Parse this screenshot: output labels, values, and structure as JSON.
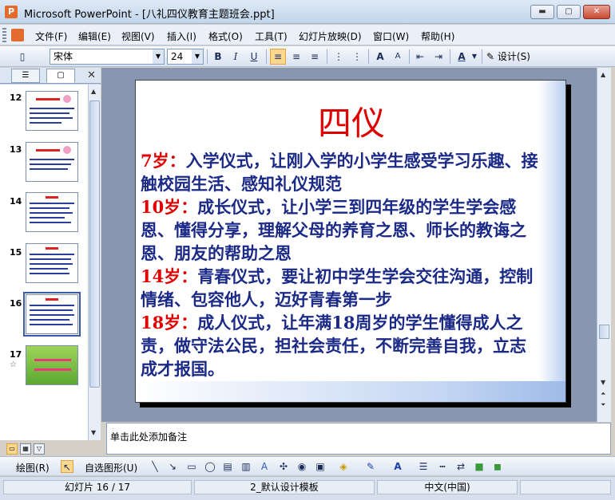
{
  "window": {
    "title": "Microsoft PowerPoint - [八礼四仪教育主题班会.ppt]",
    "min_label": "▬",
    "max_label": "▢",
    "close_label": "✕"
  },
  "menubar": {
    "items": [
      "文件(F)",
      "编辑(E)",
      "视图(V)",
      "插入(I)",
      "格式(O)",
      "工具(T)",
      "幻灯片放映(D)",
      "窗口(W)",
      "帮助(H)"
    ]
  },
  "toolbar": {
    "font_name": "宋体",
    "font_size": "24",
    "bold": "B",
    "italic": "I",
    "underline": "U",
    "grow_font": "A",
    "shrink_font": "A",
    "font_color": "A",
    "design_label": "设计(S)"
  },
  "panel": {
    "tab_outline": "☰",
    "tab_slides": "▢",
    "close": "✕"
  },
  "thumbnails": [
    {
      "num": "12"
    },
    {
      "num": "13"
    },
    {
      "num": "14"
    },
    {
      "num": "15"
    },
    {
      "num": "16"
    },
    {
      "num": "17"
    }
  ],
  "slide": {
    "title": "四仪",
    "paragraphs": [
      {
        "age": "7岁：",
        "text": "入学仪式，让刚入学的小学生感受学习乐趣、接触校园生活、感知礼仪规范"
      },
      {
        "age": "10岁：",
        "text": "成长仪式，让小学三到四年级的学生学会感恩、懂得分享，理解父母的养育之恩、师长的教诲之恩、朋友的帮助之恩"
      },
      {
        "age": "14岁：",
        "text": "青春仪式，要让初中学生学会交往沟通，控制情绪、包容他人，迈好青春第一步"
      },
      {
        "age": "18岁：",
        "text": "成人仪式，让年满18周岁的学生懂得成人之责，做守法公民，担社会责任，不断完善自我，立志成才报国。"
      }
    ]
  },
  "notes": {
    "placeholder": "单击此处添加备注"
  },
  "drawbar": {
    "draw_label": "绘图(R)",
    "autoshape_label": "自选图形(U)"
  },
  "status": {
    "slide_info": "幻灯片 16 / 17",
    "design_template": "2_默认设计模板",
    "language": "中文(中国)"
  },
  "colors": {
    "accent_red": "#e00000",
    "body_blue": "#1b2a86"
  }
}
